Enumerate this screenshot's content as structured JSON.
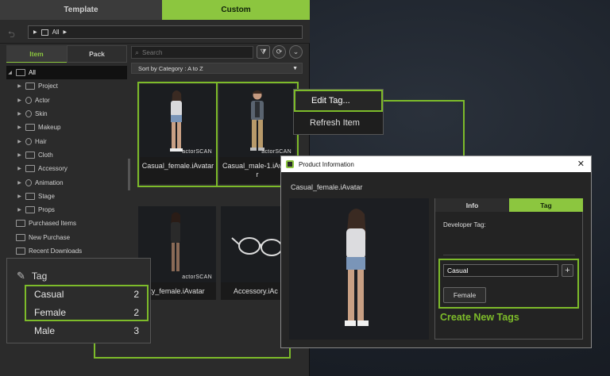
{
  "library": {
    "tabs": {
      "template": "Template",
      "custom": "Custom"
    },
    "breadcrumb": "All",
    "filter_tabs": {
      "item": "Item",
      "pack": "Pack"
    },
    "tree": [
      {
        "label": "All",
        "icon": "folder-icon",
        "selected": true
      },
      {
        "label": "Project",
        "icon": "folder-icon"
      },
      {
        "label": "Actor",
        "icon": "actor-icon"
      },
      {
        "label": "Skin",
        "icon": "skin-icon"
      },
      {
        "label": "Makeup",
        "icon": "makeup-icon"
      },
      {
        "label": "Hair",
        "icon": "hair-icon"
      },
      {
        "label": "Cloth",
        "icon": "cloth-icon"
      },
      {
        "label": "Accessory",
        "icon": "accessory-icon"
      },
      {
        "label": "Animation",
        "icon": "animation-icon"
      },
      {
        "label": "Stage",
        "icon": "stage-icon"
      },
      {
        "label": "Props",
        "icon": "props-icon"
      },
      {
        "label": "Purchased Items",
        "icon": "purchased-icon"
      },
      {
        "label": "New Purchase",
        "icon": "new-purchase-icon"
      },
      {
        "label": "Recent Downloads",
        "icon": "download-icon"
      }
    ],
    "search_placeholder": "Search",
    "sort_label": "Sort by Category : A to Z",
    "thumbs": [
      {
        "caption": "Casual_female.iAvatar",
        "badge": "actorSCAN"
      },
      {
        "caption": "Casual_male-1.iAvata\nr",
        "badge": "actorSCAN"
      },
      {
        "caption": "ty_female.iAvatar",
        "badge": "actorSCAN"
      },
      {
        "caption": "Accessory.iAc",
        "badge": ""
      }
    ]
  },
  "context_menu": {
    "edit_tag": "Edit Tag...",
    "refresh_item": "Refresh Item"
  },
  "tag_panel": {
    "title": "Tag",
    "tags": [
      {
        "name": "Casual",
        "count": "2"
      },
      {
        "name": "Female",
        "count": "2"
      },
      {
        "name": "Male",
        "count": "3"
      }
    ]
  },
  "product_dialog": {
    "title": "Product Information",
    "item_name": "Casual_female.iAvatar",
    "tabs": {
      "info": "Info",
      "tag": "Tag"
    },
    "developer_tag_label": "Developer Tag:",
    "tag_input_value": "Casual",
    "add_label": "+",
    "female_tag": "Female"
  },
  "callout": "Create New Tags",
  "colors": {
    "accent": "#8cc63f",
    "highlight": "#7dbb2a"
  }
}
